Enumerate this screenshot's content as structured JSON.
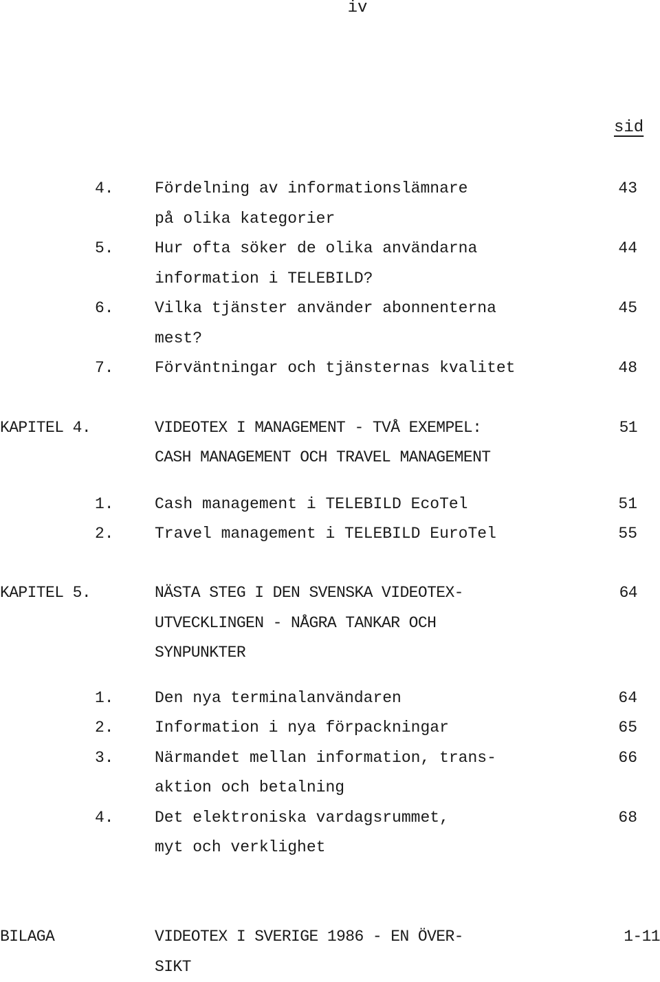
{
  "page": {
    "page_number": "iv",
    "column_header": "sid"
  },
  "toc": {
    "section_items_top": [
      {
        "number": "4.",
        "lines": [
          "Fördelning av informationslämnare",
          "på olika kategorier"
        ],
        "page": "43"
      },
      {
        "number": "5.",
        "lines": [
          "Hur ofta söker de olika användarna",
          "information i TELEBILD?"
        ],
        "page": "44"
      },
      {
        "number": "6.",
        "lines": [
          "Vilka tjänster använder abonnenterna",
          "mest?"
        ],
        "page": "45"
      },
      {
        "number": "7.",
        "lines": [
          "Förväntningar och tjänsternas kvalitet"
        ],
        "page": "48"
      }
    ],
    "chapter4": {
      "label": "KAPITEL 4.",
      "lines": [
        "VIDEOTEX I MANAGEMENT - TVÅ EXEMPEL:",
        "CASH MANAGEMENT OCH TRAVEL MANAGEMENT"
      ],
      "page": "51",
      "items": [
        {
          "number": "1.",
          "lines": [
            "Cash management i TELEBILD EcoTel"
          ],
          "page": "51"
        },
        {
          "number": "2.",
          "lines": [
            "Travel management i TELEBILD EuroTel"
          ],
          "page": "55"
        }
      ]
    },
    "chapter5": {
      "label": "KAPITEL 5.",
      "lines": [
        "NÄSTA STEG I DEN SVENSKA VIDEOTEX-",
        "UTVECKLINGEN - NÅGRA TANKAR OCH",
        "SYNPUNKTER"
      ],
      "page": "64",
      "items": [
        {
          "number": "1.",
          "lines": [
            "Den nya terminalanvändaren"
          ],
          "page": "64"
        },
        {
          "number": "2.",
          "lines": [
            "Information i nya förpackningar"
          ],
          "page": "65"
        },
        {
          "number": "3.",
          "lines": [
            "Närmandet mellan information, trans-",
            "aktion och betalning"
          ],
          "page": "66"
        },
        {
          "number": "4.",
          "lines": [
            "Det elektroniska vardagsrummet,",
            "myt och verklighet"
          ],
          "page": "68"
        }
      ]
    },
    "appendix": {
      "label": "BILAGA",
      "lines": [
        "VIDEOTEX I SVERIGE 1986 - EN ÖVER-",
        "SIKT"
      ],
      "page": "1-11"
    }
  }
}
